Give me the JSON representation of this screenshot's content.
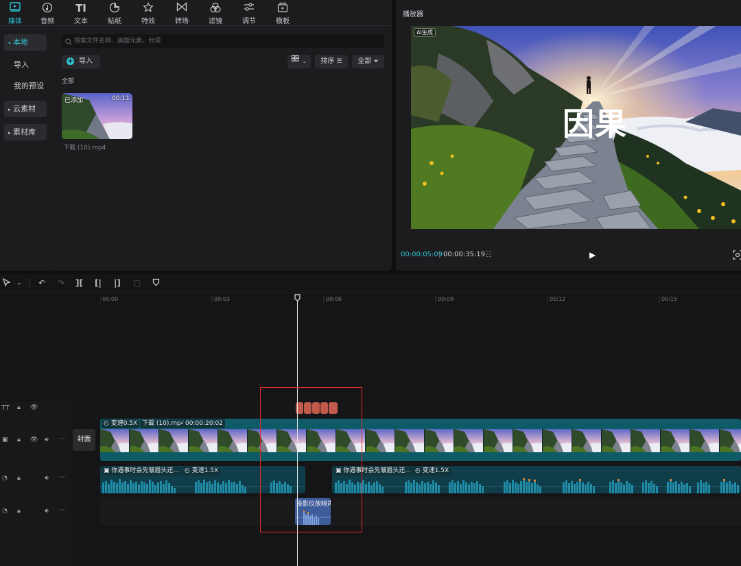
{
  "toolbar": {
    "tabs": [
      {
        "label": "媒体",
        "icon": "media-icon"
      },
      {
        "label": "音频",
        "icon": "audio-icon"
      },
      {
        "label": "文本",
        "icon": "text-icon"
      },
      {
        "label": "贴纸",
        "icon": "sticker-icon"
      },
      {
        "label": "特效",
        "icon": "effects-icon"
      },
      {
        "label": "转场",
        "icon": "transition-icon"
      },
      {
        "label": "滤镜",
        "icon": "filter-icon"
      },
      {
        "label": "调节",
        "icon": "adjust-icon"
      },
      {
        "label": "模板",
        "icon": "template-icon"
      }
    ],
    "text_glyph": "TI"
  },
  "sidebar": {
    "items": [
      {
        "label": "本地"
      },
      {
        "label": "导入"
      },
      {
        "label": "我的预设"
      },
      {
        "label": "云素材"
      },
      {
        "label": "素材库"
      }
    ]
  },
  "media": {
    "search_placeholder": "搜索文件名称、画面元素、台词",
    "import_label": "导入",
    "sort_label": "排序",
    "all_filter_label": "全部",
    "section_label": "全部",
    "clip": {
      "badge_added": "已添加",
      "duration": "00:11",
      "filename": "下载 (10).mp4"
    }
  },
  "player": {
    "title": "播放器",
    "ai_badge": "AI生成",
    "overlay_text": "因果",
    "current_time": "00:00:05:09",
    "total_time": "00:00:35:19"
  },
  "timeline": {
    "ruler": [
      "00:00",
      "00:03",
      "00:06",
      "00:09",
      "00:12",
      "00:15"
    ],
    "cover_label": "封面",
    "video_clip": {
      "speed": "变速0.5X",
      "name": "下载 (10).mp4",
      "duration": "00:00:20:02"
    },
    "audio_clip_a": {
      "name": "你遇事时会先皱眉头还...",
      "speed": "变速1.5X"
    },
    "audio_clip_b": {
      "name": "你遇事时会先皱眉头还...",
      "speed": "变速1.5X"
    },
    "sfx_clip": {
      "name": "投影仪放映声"
    }
  },
  "colors": {
    "accent": "#2fc5d5",
    "video_track": "#0e5a66",
    "audio_track": "#0f3d4a",
    "text_clip": "#c15a4a",
    "highlight_box": "#e22a2a"
  }
}
